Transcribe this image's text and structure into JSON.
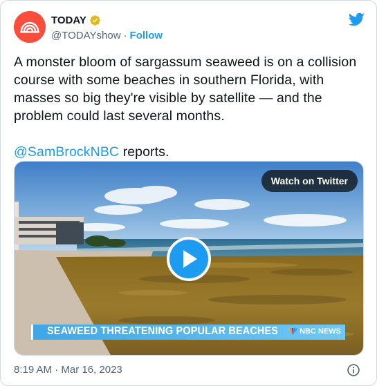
{
  "author": {
    "display_name": "TODAY",
    "handle": "@TODAYshow",
    "separator": "·",
    "follow_label": "Follow",
    "avatar_color": "#fa4d3c",
    "verified_color": "#e2b719"
  },
  "tweet": {
    "text_main": "A monster bloom of sargassum seaweed is on a collision course with some beaches in southern Florida, with masses so big they're visible by satellite — and the problem could last several months.",
    "mention": "@SamBrockNBC",
    "text_after_mention": " reports."
  },
  "media": {
    "watch_label": "Watch on Twitter",
    "banner_text": "SEAWEED THREATENING POPULAR BEACHES",
    "banner_brand": "NBC NEWS"
  },
  "footer": {
    "timestamp": "8:19 AM · Mar 16, 2023"
  },
  "icons": {
    "brand_icon": "twitter-bird-icon",
    "play_icon": "play-icon",
    "info_icon": "info-icon"
  },
  "colors": {
    "accent": "#1d9bf0",
    "text": "#0f1419",
    "muted": "#536471"
  }
}
